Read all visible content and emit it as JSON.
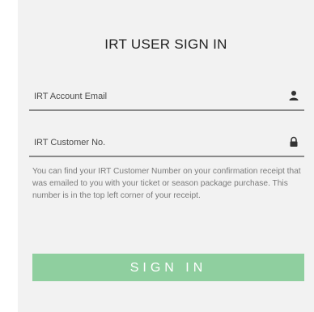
{
  "form": {
    "title": "IRT USER SIGN IN",
    "email_placeholder": "IRT Account Email",
    "email_icon": "user-icon",
    "customer_placeholder": "IRT Customer No.",
    "customer_icon": "lock-icon",
    "help_text": "You can find your IRT Customer Number on your confirmation receipt that was emailed to you with your ticket or season package purchase. This number is in the top left corner of your receipt.",
    "signin_label": "SIGN IN"
  },
  "colors": {
    "card_background": "#f2f2f2",
    "button": "#8fcf9f",
    "button_text": "#ffffff",
    "underline": "#8a8a8a"
  }
}
